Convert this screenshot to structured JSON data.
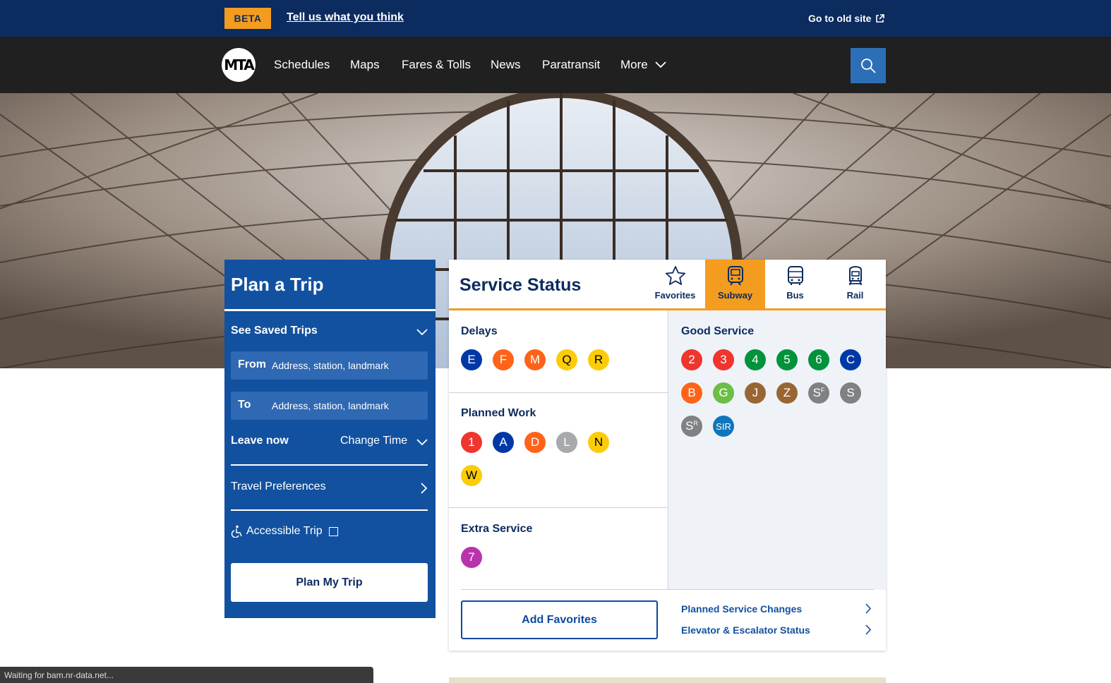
{
  "banner": {
    "badge": "BETA",
    "feedback_link": "Tell us what you think",
    "old_site": "Go to old site"
  },
  "nav": {
    "logo": "MTA",
    "items": [
      "Schedules",
      "Maps",
      "Fares & Tolls",
      "News",
      "Paratransit",
      "More"
    ]
  },
  "trip": {
    "title": "Plan a Trip",
    "saved_trips": "See Saved Trips",
    "from_label": "From",
    "from_placeholder": "Address, station, landmark",
    "to_label": "To",
    "to_placeholder": "Address, station, landmark",
    "leave_now": "Leave now",
    "change_time": "Change Time",
    "travel_preferences": "Travel Preferences",
    "accessible_trip": "Accessible Trip",
    "plan_button": "Plan My Trip"
  },
  "status": {
    "title": "Service Status",
    "tabs": [
      "Favorites",
      "Subway",
      "Bus",
      "Rail"
    ],
    "active_tab": "Subway",
    "delays": {
      "title": "Delays",
      "lines": [
        {
          "label": "E",
          "color": "#0039a6",
          "text": "#ffffff"
        },
        {
          "label": "F",
          "color": "#ff6319",
          "text": "#ffffff"
        },
        {
          "label": "M",
          "color": "#ff6319",
          "text": "#ffffff"
        },
        {
          "label": "Q",
          "color": "#fccc0a",
          "text": "#000000"
        },
        {
          "label": "R",
          "color": "#fccc0a",
          "text": "#000000"
        }
      ]
    },
    "planned_work": {
      "title": "Planned Work",
      "lines": [
        {
          "label": "1",
          "color": "#ee352e",
          "text": "#ffffff"
        },
        {
          "label": "A",
          "color": "#0039a6",
          "text": "#ffffff"
        },
        {
          "label": "D",
          "color": "#ff6319",
          "text": "#ffffff"
        },
        {
          "label": "L",
          "color": "#a7a9ac",
          "text": "#ffffff"
        },
        {
          "label": "N",
          "color": "#fccc0a",
          "text": "#000000"
        },
        {
          "label": "W",
          "color": "#fccc0a",
          "text": "#000000"
        }
      ]
    },
    "extra_service": {
      "title": "Extra Service",
      "lines": [
        {
          "label": "7",
          "color": "#b933ad",
          "text": "#ffffff"
        }
      ]
    },
    "good_service": {
      "title": "Good Service",
      "lines": [
        {
          "label": "2",
          "color": "#ee352e",
          "text": "#ffffff"
        },
        {
          "label": "3",
          "color": "#ee352e",
          "text": "#ffffff"
        },
        {
          "label": "4",
          "color": "#00933c",
          "text": "#ffffff"
        },
        {
          "label": "5",
          "color": "#00933c",
          "text": "#ffffff"
        },
        {
          "label": "6",
          "color": "#00933c",
          "text": "#ffffff"
        },
        {
          "label": "C",
          "color": "#0039a6",
          "text": "#ffffff"
        },
        {
          "label": "B",
          "color": "#ff6319",
          "text": "#ffffff"
        },
        {
          "label": "G",
          "color": "#6cbe45",
          "text": "#ffffff"
        },
        {
          "label": "J",
          "color": "#996633",
          "text": "#ffffff"
        },
        {
          "label": "Z",
          "color": "#996633",
          "text": "#ffffff"
        },
        {
          "label": "S",
          "sup": "F",
          "color": "#808183",
          "text": "#ffffff"
        },
        {
          "label": "S",
          "color": "#808183",
          "text": "#ffffff"
        },
        {
          "label": "S",
          "sup": "R",
          "color": "#808183",
          "text": "#ffffff"
        },
        {
          "label": "SIR",
          "color": "#0f75bc",
          "text": "#ffffff"
        }
      ]
    },
    "add_favorites": "Add Favorites",
    "links": [
      "Planned Service Changes",
      "Elevator & Escalator Status"
    ]
  },
  "browser_status": "Waiting for bam.nr-data.net...",
  "colors": {
    "navy": "#0c2b5f",
    "blue": "#1251a0",
    "orange": "#f39c1f",
    "dark": "#202020"
  }
}
